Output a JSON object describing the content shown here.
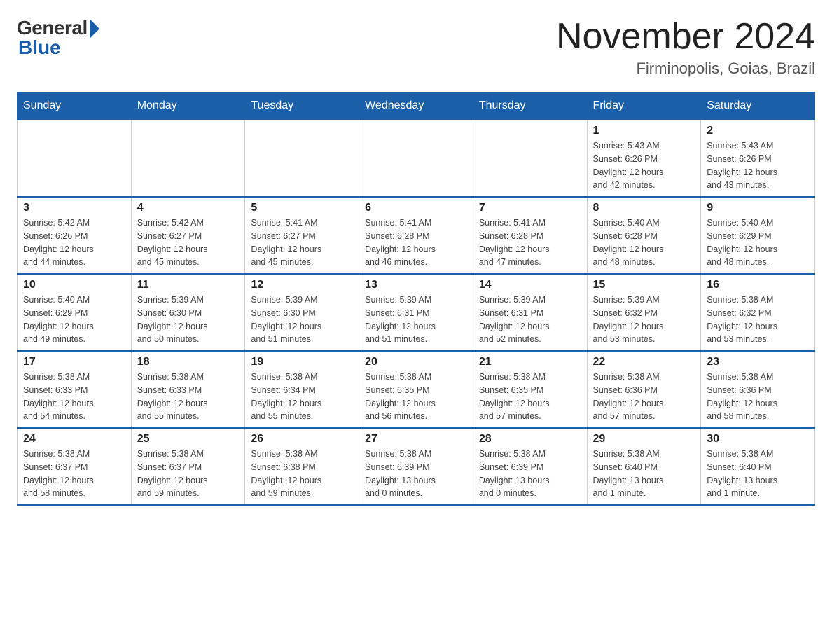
{
  "header": {
    "logo_general": "General",
    "logo_blue": "Blue",
    "month_title": "November 2024",
    "subtitle": "Firminopolis, Goias, Brazil"
  },
  "days_of_week": [
    "Sunday",
    "Monday",
    "Tuesday",
    "Wednesday",
    "Thursday",
    "Friday",
    "Saturday"
  ],
  "weeks": [
    [
      {
        "day": "",
        "info": ""
      },
      {
        "day": "",
        "info": ""
      },
      {
        "day": "",
        "info": ""
      },
      {
        "day": "",
        "info": ""
      },
      {
        "day": "",
        "info": ""
      },
      {
        "day": "1",
        "info": "Sunrise: 5:43 AM\nSunset: 6:26 PM\nDaylight: 12 hours\nand 42 minutes."
      },
      {
        "day": "2",
        "info": "Sunrise: 5:43 AM\nSunset: 6:26 PM\nDaylight: 12 hours\nand 43 minutes."
      }
    ],
    [
      {
        "day": "3",
        "info": "Sunrise: 5:42 AM\nSunset: 6:26 PM\nDaylight: 12 hours\nand 44 minutes."
      },
      {
        "day": "4",
        "info": "Sunrise: 5:42 AM\nSunset: 6:27 PM\nDaylight: 12 hours\nand 45 minutes."
      },
      {
        "day": "5",
        "info": "Sunrise: 5:41 AM\nSunset: 6:27 PM\nDaylight: 12 hours\nand 45 minutes."
      },
      {
        "day": "6",
        "info": "Sunrise: 5:41 AM\nSunset: 6:28 PM\nDaylight: 12 hours\nand 46 minutes."
      },
      {
        "day": "7",
        "info": "Sunrise: 5:41 AM\nSunset: 6:28 PM\nDaylight: 12 hours\nand 47 minutes."
      },
      {
        "day": "8",
        "info": "Sunrise: 5:40 AM\nSunset: 6:28 PM\nDaylight: 12 hours\nand 48 minutes."
      },
      {
        "day": "9",
        "info": "Sunrise: 5:40 AM\nSunset: 6:29 PM\nDaylight: 12 hours\nand 48 minutes."
      }
    ],
    [
      {
        "day": "10",
        "info": "Sunrise: 5:40 AM\nSunset: 6:29 PM\nDaylight: 12 hours\nand 49 minutes."
      },
      {
        "day": "11",
        "info": "Sunrise: 5:39 AM\nSunset: 6:30 PM\nDaylight: 12 hours\nand 50 minutes."
      },
      {
        "day": "12",
        "info": "Sunrise: 5:39 AM\nSunset: 6:30 PM\nDaylight: 12 hours\nand 51 minutes."
      },
      {
        "day": "13",
        "info": "Sunrise: 5:39 AM\nSunset: 6:31 PM\nDaylight: 12 hours\nand 51 minutes."
      },
      {
        "day": "14",
        "info": "Sunrise: 5:39 AM\nSunset: 6:31 PM\nDaylight: 12 hours\nand 52 minutes."
      },
      {
        "day": "15",
        "info": "Sunrise: 5:39 AM\nSunset: 6:32 PM\nDaylight: 12 hours\nand 53 minutes."
      },
      {
        "day": "16",
        "info": "Sunrise: 5:38 AM\nSunset: 6:32 PM\nDaylight: 12 hours\nand 53 minutes."
      }
    ],
    [
      {
        "day": "17",
        "info": "Sunrise: 5:38 AM\nSunset: 6:33 PM\nDaylight: 12 hours\nand 54 minutes."
      },
      {
        "day": "18",
        "info": "Sunrise: 5:38 AM\nSunset: 6:33 PM\nDaylight: 12 hours\nand 55 minutes."
      },
      {
        "day": "19",
        "info": "Sunrise: 5:38 AM\nSunset: 6:34 PM\nDaylight: 12 hours\nand 55 minutes."
      },
      {
        "day": "20",
        "info": "Sunrise: 5:38 AM\nSunset: 6:35 PM\nDaylight: 12 hours\nand 56 minutes."
      },
      {
        "day": "21",
        "info": "Sunrise: 5:38 AM\nSunset: 6:35 PM\nDaylight: 12 hours\nand 57 minutes."
      },
      {
        "day": "22",
        "info": "Sunrise: 5:38 AM\nSunset: 6:36 PM\nDaylight: 12 hours\nand 57 minutes."
      },
      {
        "day": "23",
        "info": "Sunrise: 5:38 AM\nSunset: 6:36 PM\nDaylight: 12 hours\nand 58 minutes."
      }
    ],
    [
      {
        "day": "24",
        "info": "Sunrise: 5:38 AM\nSunset: 6:37 PM\nDaylight: 12 hours\nand 58 minutes."
      },
      {
        "day": "25",
        "info": "Sunrise: 5:38 AM\nSunset: 6:37 PM\nDaylight: 12 hours\nand 59 minutes."
      },
      {
        "day": "26",
        "info": "Sunrise: 5:38 AM\nSunset: 6:38 PM\nDaylight: 12 hours\nand 59 minutes."
      },
      {
        "day": "27",
        "info": "Sunrise: 5:38 AM\nSunset: 6:39 PM\nDaylight: 13 hours\nand 0 minutes."
      },
      {
        "day": "28",
        "info": "Sunrise: 5:38 AM\nSunset: 6:39 PM\nDaylight: 13 hours\nand 0 minutes."
      },
      {
        "day": "29",
        "info": "Sunrise: 5:38 AM\nSunset: 6:40 PM\nDaylight: 13 hours\nand 1 minute."
      },
      {
        "day": "30",
        "info": "Sunrise: 5:38 AM\nSunset: 6:40 PM\nDaylight: 13 hours\nand 1 minute."
      }
    ]
  ]
}
